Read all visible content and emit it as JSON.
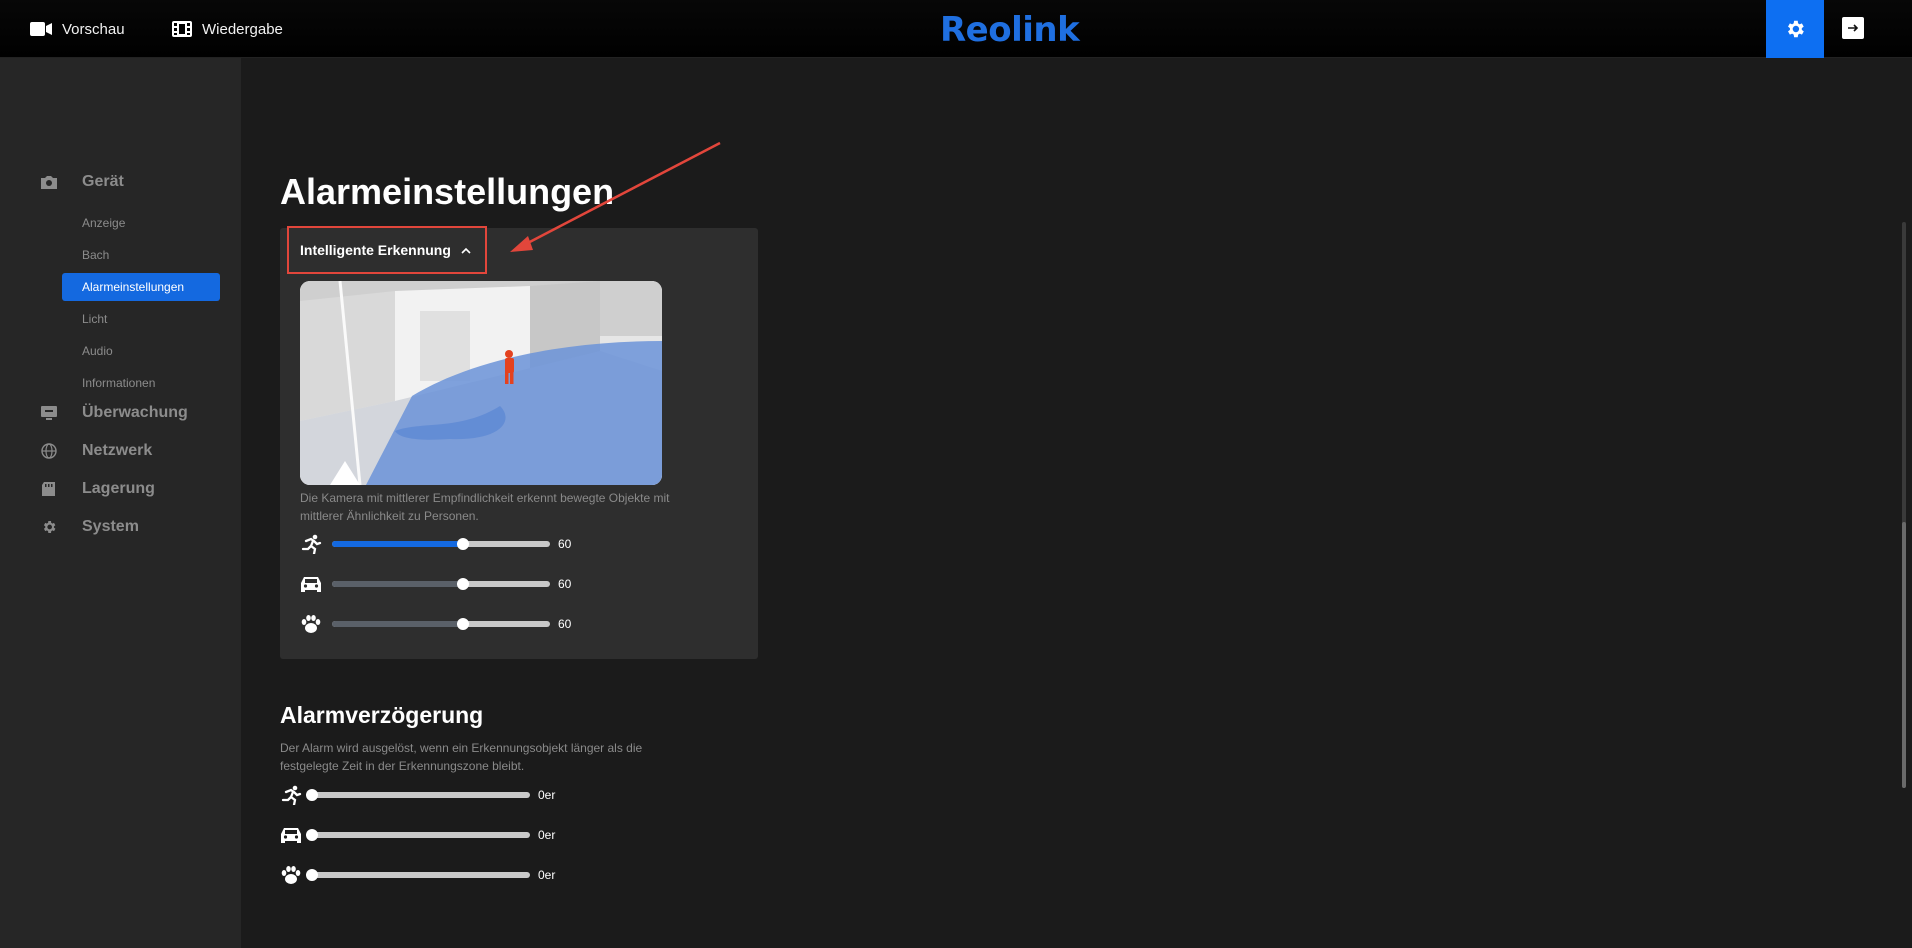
{
  "topbar": {
    "preview_label": "Vorschau",
    "playback_label": "Wiedergabe",
    "brand": "Reolink"
  },
  "sidebar": {
    "groups": [
      {
        "label": "Gerät",
        "icon": "camera-icon"
      },
      {
        "label": "Überwachung",
        "icon": "monitor-icon"
      },
      {
        "label": "Netzwerk",
        "icon": "globe-icon"
      },
      {
        "label": "Lagerung",
        "icon": "storage-icon"
      },
      {
        "label": "System",
        "icon": "gear-icon"
      }
    ],
    "device_items": [
      {
        "label": "Anzeige"
      },
      {
        "label": "Bach"
      },
      {
        "label": "Alarmeinstellungen",
        "active": true
      },
      {
        "label": "Licht"
      },
      {
        "label": "Audio"
      },
      {
        "label": "Informationen"
      }
    ]
  },
  "main": {
    "title": "Alarmeinstellungen",
    "smart_detection": {
      "header": "Intelligente Erkennung",
      "description": "Die Kamera mit mittlerer Empfindlichkeit erkennt bewegte Objekte mit mittlerer Ähnlichkeit zu Personen.",
      "sliders": [
        {
          "icon": "person-running-icon",
          "value": 60,
          "display": "60",
          "max": 100,
          "active": true
        },
        {
          "icon": "car-icon",
          "value": 60,
          "display": "60",
          "max": 100,
          "active": false
        },
        {
          "icon": "paw-icon",
          "value": 60,
          "display": "60",
          "max": 100,
          "active": false
        }
      ]
    },
    "alarm_delay": {
      "title": "Alarmverzögerung",
      "description": "Der Alarm wird ausgelöst, wenn ein Erkennungsobjekt länger als die festgelegte Zeit in der Erkennungszone bleibt.",
      "sliders": [
        {
          "icon": "person-running-icon",
          "value": 0,
          "display": "0er"
        },
        {
          "icon": "car-icon",
          "value": 0,
          "display": "0er"
        },
        {
          "icon": "paw-icon",
          "value": 0,
          "display": "0er"
        }
      ]
    }
  },
  "colors": {
    "accent": "#1469e0",
    "settings_bg": "#0d6ff2",
    "annotation_red": "#e2463b",
    "brand_blue": "#1f6fe0"
  }
}
